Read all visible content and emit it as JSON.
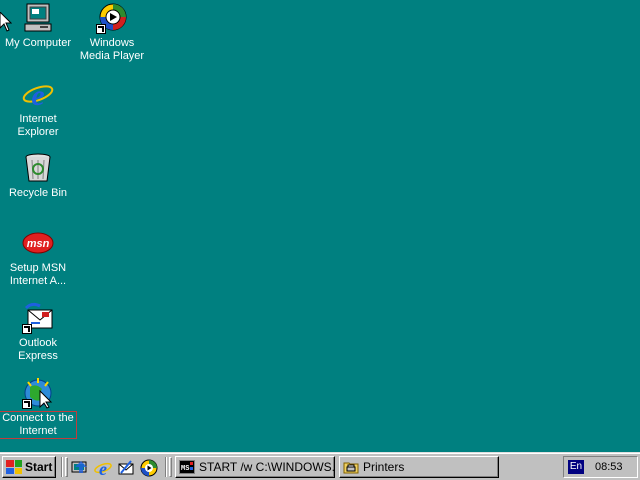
{
  "desktop": {
    "background": "#008080",
    "icons": [
      {
        "label": "My Computer",
        "icon": "my-computer-icon"
      },
      {
        "label": "Windows\nMedia Player",
        "icon": "media-player-icon"
      },
      {
        "label": "Internet\nExplorer",
        "icon": "internet-explorer-icon"
      },
      {
        "label": "Recycle Bin",
        "icon": "recycle-bin-icon"
      },
      {
        "label": "Setup MSN\nInternet A...",
        "icon": "msn-icon"
      },
      {
        "label": "Outlook\nExpress",
        "icon": "outlook-express-icon"
      },
      {
        "label": "Connect to the\nInternet",
        "icon": "connect-internet-icon"
      }
    ]
  },
  "taskbar": {
    "start_label": "Start",
    "quick_launch": [
      "show-desktop-icon",
      "internet-explorer-icon",
      "outlook-express-icon",
      "media-player-icon"
    ],
    "tasks": [
      {
        "label": "START /w C:\\WINDOWS...",
        "icon": "msdos-icon"
      },
      {
        "label": "Printers",
        "icon": "printers-folder-icon"
      }
    ],
    "language": "En",
    "clock": "08:53"
  }
}
